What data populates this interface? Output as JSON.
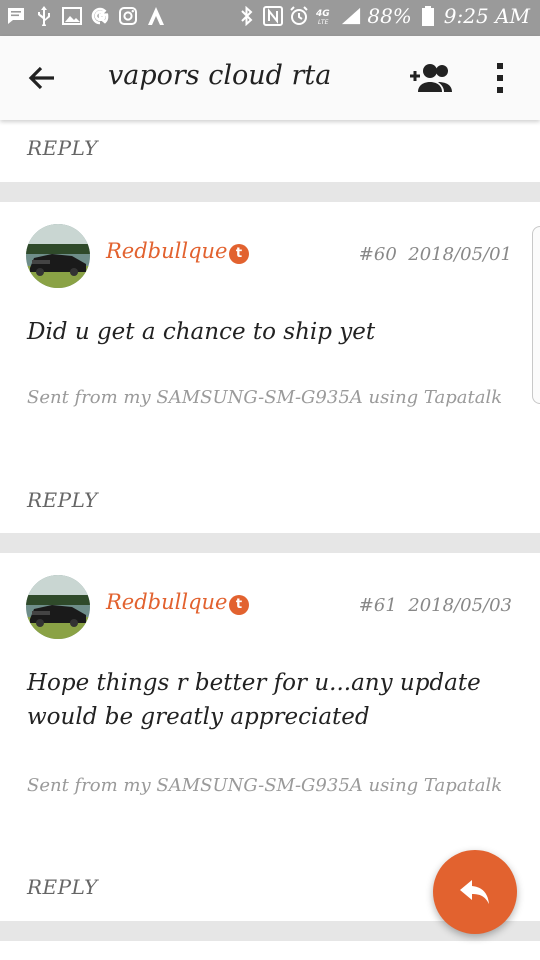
{
  "status_bar": {
    "battery": "88%",
    "time": "9:25 AM",
    "network": "4G LTE"
  },
  "app_bar": {
    "title": "vapors cloud rta"
  },
  "previous_post": {
    "reply_label": "REPLY"
  },
  "posts": [
    {
      "author": "Redbullque",
      "badge": "t",
      "number": "#60",
      "date": "2018/05/01",
      "message": "Did u get a chance to ship yet",
      "signature": "Sent from my SAMSUNG-SM-G935A using Tapatalk",
      "reply_label": "REPLY"
    },
    {
      "author": "Redbullque",
      "badge": "t",
      "number": "#61",
      "date": "2018/05/03",
      "message": "Hope things r better for u...any update would be greatly appreciated",
      "signature": "Sent from my SAMSUNG-SM-G935A using Tapatalk",
      "reply_label": "REPLY"
    }
  ],
  "colors": {
    "accent": "#e2622f",
    "background": "#e6e6e6",
    "card": "#ffffff",
    "status_bar": "#9a9a9a"
  },
  "icons": {
    "back": "arrow-back-icon",
    "add_user": "add-user-icon",
    "more": "more-vert-icon",
    "fab": "reply-icon"
  }
}
